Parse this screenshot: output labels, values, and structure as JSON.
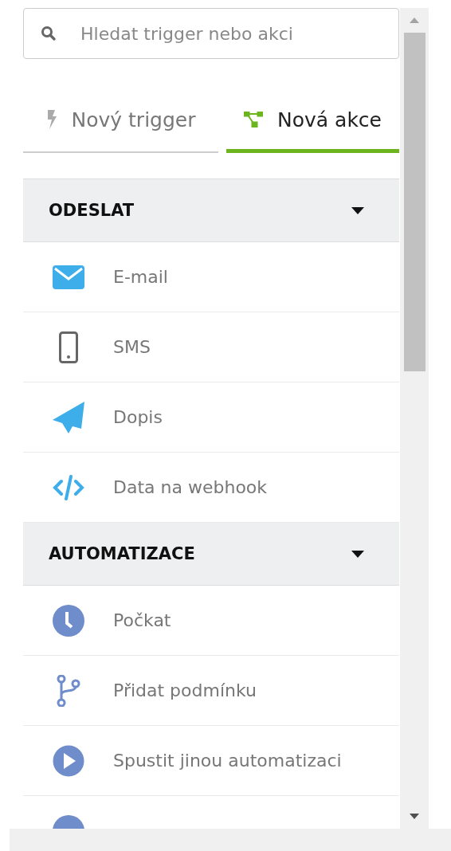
{
  "search": {
    "placeholder": "Hledat trigger nebo akci"
  },
  "tabs": [
    {
      "label": "Nový trigger",
      "kind": "trigger",
      "selected": false
    },
    {
      "label": "Nová akce",
      "kind": "action",
      "selected": true
    }
  ],
  "sections": [
    {
      "title": "ODESLAT",
      "expanded": true,
      "items": [
        {
          "label": "E-mail",
          "kind": "email"
        },
        {
          "label": "SMS",
          "kind": "sms"
        },
        {
          "label": "Dopis",
          "kind": "letter"
        },
        {
          "label": "Data na webhook",
          "kind": "webhook"
        }
      ]
    },
    {
      "title": "AUTOMATIZACE",
      "expanded": true,
      "items": [
        {
          "label": "Počkat",
          "kind": "wait"
        },
        {
          "label": "Přidat podmínku",
          "kind": "condition"
        },
        {
          "label": "Spustit jinou automatizaci",
          "kind": "run"
        },
        {
          "kind": "other"
        }
      ]
    }
  ]
}
